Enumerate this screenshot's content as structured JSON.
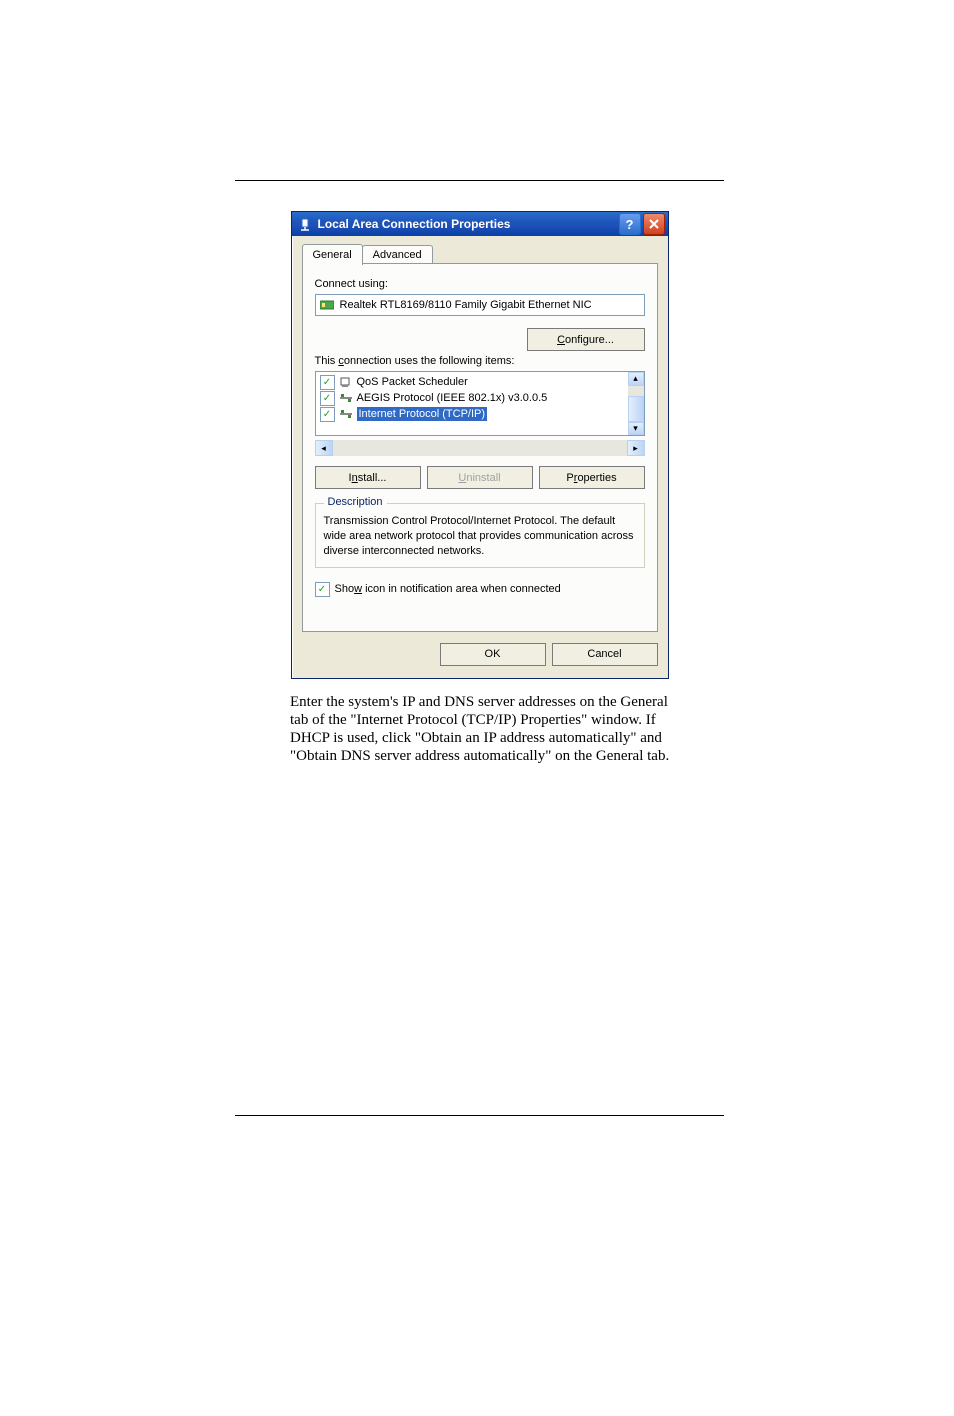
{
  "dialog": {
    "title": "Local Area Connection Properties",
    "tabs": {
      "general": "General",
      "advanced": "Advanced"
    },
    "connect_using_label": "Connect using:",
    "adapter_name": "Realtek RTL8169/8110 Family Gigabit Ethernet NIC",
    "configure_label": "Configure...",
    "items_label": "This connection uses the following items:",
    "items": [
      {
        "label": "QoS Packet Scheduler",
        "checked": true,
        "selected": false
      },
      {
        "label": "AEGIS Protocol (IEEE 802.1x) v3.0.0.5",
        "checked": true,
        "selected": false
      },
      {
        "label": "Internet Protocol (TCP/IP)",
        "checked": true,
        "selected": true
      }
    ],
    "install_label": "Install...",
    "uninstall_label": "Uninstall",
    "properties_label": "Properties",
    "description_legend": "Description",
    "description_text": "Transmission Control Protocol/Internet Protocol. The default wide area network protocol that provides communication across diverse interconnected networks.",
    "show_icon_label": "Show icon in notification area when connected",
    "show_icon_checked": true,
    "ok_label": "OK",
    "cancel_label": "Cancel"
  },
  "paragraph": "Enter the system's IP and DNS server addresses on the General tab of the \"Internet Protocol (TCP/IP) Properties\" window.  If DHCP is used, click \"Obtain an IP address automatically\" and \"Obtain DNS server address automatically\" on the General tab."
}
